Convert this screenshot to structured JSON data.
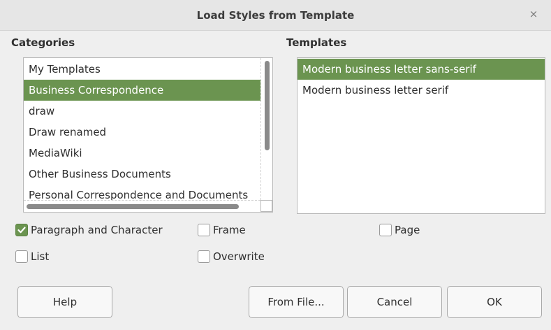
{
  "window": {
    "title": "Load Styles from Template",
    "close_glyph": "×"
  },
  "categories": {
    "label": "Categories",
    "items": [
      {
        "label": "My Templates",
        "selected": false
      },
      {
        "label": "Business Correspondence",
        "selected": true
      },
      {
        "label": "draw",
        "selected": false
      },
      {
        "label": "Draw renamed",
        "selected": false
      },
      {
        "label": "MediaWiki",
        "selected": false
      },
      {
        "label": "Other Business Documents",
        "selected": false
      },
      {
        "label": "Personal Correspondence and Documents",
        "selected": false
      }
    ]
  },
  "templates": {
    "label": "Templates",
    "items": [
      {
        "label": "Modern business letter sans-serif",
        "selected": true
      },
      {
        "label": "Modern business letter serif",
        "selected": false
      }
    ]
  },
  "options": {
    "paragraph": {
      "label": "Paragraph and Character",
      "checked": true
    },
    "frame": {
      "label": "Frame",
      "checked": false
    },
    "page": {
      "label": "Page",
      "checked": false
    },
    "list": {
      "label": "List",
      "checked": false
    },
    "overwrite": {
      "label": "Overwrite",
      "checked": false
    }
  },
  "buttons": {
    "help": "Help",
    "from_file": "From File...",
    "cancel": "Cancel",
    "ok": "OK"
  },
  "colors": {
    "selection": "#6b9450",
    "background": "#efefef"
  }
}
